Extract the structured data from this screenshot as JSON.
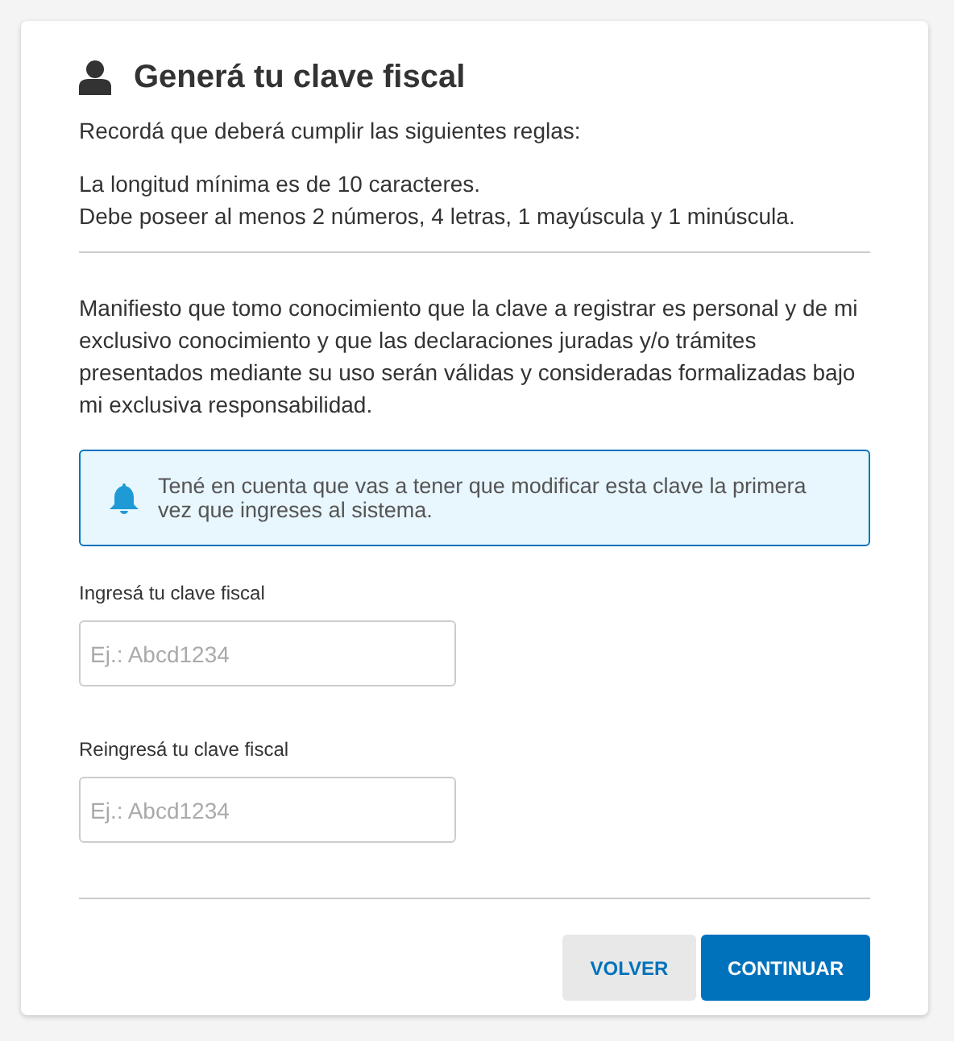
{
  "title": "Generá tu clave fiscal",
  "intro": "Recordá que deberá cumplir las siguientes reglas:",
  "rules": [
    "La longitud mínima es de 10 caracteres.",
    "Debe poseer al menos 2 números, 4 letras, 1 mayúscula y 1 minúscula."
  ],
  "statement": "Manifiesto que tomo conocimiento que la clave a registrar es personal y de mi exclusivo conocimiento y que las declaraciones juradas y/o trámites presentados mediante su uso serán válidas y consideradas formalizadas bajo mi exclusiva responsabilidad.",
  "notice": "Tené en cuenta que vas a tener que modificar esta clave la primera vez que ingreses al sistema.",
  "fields": [
    {
      "label": "Ingresá tu clave fiscal",
      "placeholder": "Ej.: Abcd1234"
    },
    {
      "label": "Reingresá tu clave fiscal",
      "placeholder": "Ej.: Abcd1234"
    }
  ],
  "buttons": [
    {
      "label": "VOLVER",
      "kind": "secondary"
    },
    {
      "label": "CONTINUAR",
      "kind": "primary"
    }
  ]
}
